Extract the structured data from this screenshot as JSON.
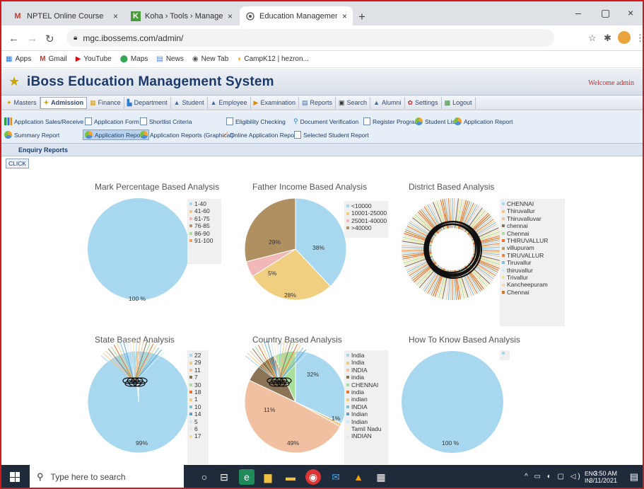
{
  "browser": {
    "tabs": [
      {
        "label": "NPTEL Online Course - hencyjuli",
        "icon": "M",
        "icon_color": "#c0392b"
      },
      {
        "label": "Koha › Tools › Manage staged M",
        "icon": "K",
        "icon_color": "#2e7d32"
      },
      {
        "label": "Education Management System",
        "icon": "globe-icon",
        "icon_color": "#555"
      }
    ],
    "tab_close": "×",
    "new_tab": "+",
    "window_controls": {
      "minimize": "–",
      "maximize": "▢",
      "close": "×"
    },
    "url": "mgc.ibossems.com/admin/",
    "bookmarks": [
      {
        "label": "Apps",
        "icon": "apps-grid-icon"
      },
      {
        "label": "Gmail",
        "icon": "gmail-icon"
      },
      {
        "label": "YouTube",
        "icon": "youtube-icon"
      },
      {
        "label": "Maps",
        "icon": "maps-pin-icon"
      },
      {
        "label": "News",
        "icon": "news-icon"
      },
      {
        "label": "New Tab",
        "icon": "chrome-icon"
      },
      {
        "label": "CampK12 | hezron...",
        "icon": "campk12-icon"
      }
    ]
  },
  "app": {
    "title": "iBoss Education Management System",
    "welcome": "Welcome admin",
    "menu": [
      {
        "label": "Masters",
        "active": false
      },
      {
        "label": "Admission",
        "active": true
      },
      {
        "label": "Finance",
        "active": false
      },
      {
        "label": "Department",
        "active": false
      },
      {
        "label": "Student",
        "active": false
      },
      {
        "label": "Employee",
        "active": false
      },
      {
        "label": "Examination",
        "active": false
      },
      {
        "label": "Reports",
        "active": false
      },
      {
        "label": "Search",
        "active": false
      },
      {
        "label": "Alumni",
        "active": false
      },
      {
        "label": "Settings",
        "active": false
      },
      {
        "label": "Logout",
        "active": false
      }
    ],
    "submenu_row1": [
      "Application Sales/Receive",
      "Application Form",
      "Shortlist Criteria",
      "Eligibility Checking",
      "Document Verification",
      "Register Program",
      "Student List",
      "Application Report"
    ],
    "submenu_row2": [
      "Summary Report",
      "Application Reports",
      "Application Reports (Graphical)",
      "Online Application Report",
      "Selected Student Report"
    ],
    "section_title": "Enquiry Reports",
    "click_button": "CLICK"
  },
  "chart_data": [
    {
      "type": "pie",
      "title": "Mark Percentage Based Analysis",
      "legend": [
        "1-40",
        "41-60",
        "61-75",
        "76-85",
        "86-90",
        "91-100"
      ],
      "colors": [
        "#a8d8f0",
        "#f0c98a",
        "#f2b7b7",
        "#b89a6a",
        "#a9dd9a",
        "#f0a060"
      ],
      "values": [
        100,
        0,
        0,
        0,
        0,
        0
      ],
      "labels": [
        "100 %"
      ]
    },
    {
      "type": "pie",
      "title": "Father Income Based Analysis",
      "legend": [
        "<10000",
        "10001-25000",
        "25001-40000",
        ">40000"
      ],
      "colors": [
        "#a8d8f0",
        "#f0d080",
        "#f2b7b7",
        "#b09060"
      ],
      "values": [
        38,
        28,
        5,
        29
      ],
      "labels": [
        "38%",
        "28%",
        "5%",
        "29%"
      ]
    },
    {
      "type": "pie",
      "title": "District Based Analysis",
      "legend": [
        "CHENNAI",
        "Thiruvallur",
        "Thiruvalluvar",
        "chennai",
        "Chennai",
        "THIRUVALLUR",
        "villupuram",
        "TIRUVALLUR",
        "Tiruvallur",
        "thiruvallur",
        "Trivallur",
        "Kancheepuram",
        "Chennai"
      ],
      "colors": [
        "#a8d8f0",
        "#f0c98a",
        "#f0c0a0",
        "#8b7355",
        "#a9dd9a",
        "#f07030",
        "#b89a6a",
        "#f08040",
        "#80c0e0",
        "#d0e8f8",
        "#f0e0a0",
        "#f8d8b0",
        "#e07020"
      ]
    },
    {
      "type": "pie",
      "title": "State Based Analysis",
      "legend": [
        "22",
        "29",
        "11",
        "7",
        "30",
        "18",
        "1",
        "10",
        "14",
        "5",
        "6",
        "17"
      ],
      "colors": [
        "#a8d8f0",
        "#f0c98a",
        "#f0c0a0",
        "#8b7355",
        "#a9dd9a",
        "#f07030",
        "#f0d080",
        "#80c0e0",
        "#60a0d0",
        "#d0e8f8",
        "#e8e8e8",
        "#f0e0a0"
      ],
      "values": [
        99,
        1
      ],
      "labels": [
        "99%"
      ]
    },
    {
      "type": "pie",
      "title": "Country Based Analysis",
      "legend": [
        "India",
        "India",
        "INDIA",
        "india",
        "CHENNAI",
        "india",
        "indian",
        "INDIA",
        "Indian",
        "Indian",
        "Tamil Nadu",
        "INDIAN"
      ],
      "colors": [
        "#a8d8f0",
        "#f0c98a",
        "#f0c0a0",
        "#8b7355",
        "#a9dd9a",
        "#f07030",
        "#f0d080",
        "#80c0e0",
        "#60a0d0",
        "#d0e8f8",
        "#f8f0d0",
        "#e8e8e8"
      ],
      "values": [
        32,
        1,
        49,
        11,
        7
      ],
      "labels": [
        "32%",
        "1%",
        "49%",
        "11%"
      ]
    },
    {
      "type": "pie",
      "title": "How To Know Based Analysis",
      "legend": [
        ""
      ],
      "colors": [
        "#a8d8f0"
      ],
      "values": [
        100
      ],
      "labels": [
        "100 %"
      ]
    }
  ],
  "taskbar": {
    "search_placeholder": "Type here to search",
    "lang": "ENG",
    "region": "IN",
    "time": "3:50 AM",
    "date": "3/11/2021"
  }
}
